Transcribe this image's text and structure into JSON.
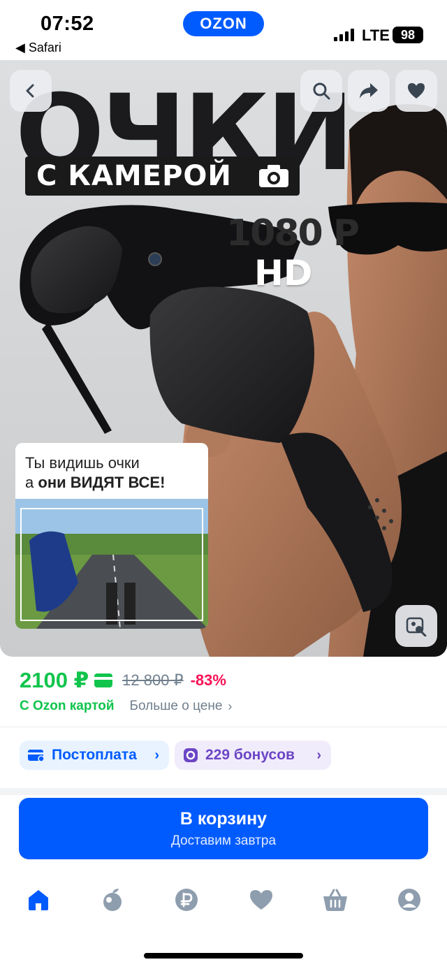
{
  "status_bar": {
    "time": "07:52",
    "back_app": "◀ Safari",
    "network": "LTE",
    "battery": "98"
  },
  "brand": {
    "logo": "OZON",
    "primary_color": "#005bff"
  },
  "product_image": {
    "title": "ОЧКИ",
    "subtitle": "С КАМЕРОЙ",
    "resolution": "1080 P",
    "quality": "HD",
    "promo_line1": "Ты видишь очки",
    "promo_line2_prefix": "а",
    "promo_line2_bold": "они ВИДЯТ ВСЕ!",
    "buttons": [
      "back-icon",
      "search-icon",
      "share-icon",
      "heart-icon",
      "image-search-icon"
    ]
  },
  "price": {
    "current": "2100 ₽",
    "old": "12 800 ₽",
    "discount": "-83%",
    "ozon_card_label": "С Ozon картой",
    "more_about_price": "Больше о цене",
    "green": "#10c44c",
    "red": "#f91155"
  },
  "chips": {
    "postpay": "Постоплата",
    "bonuses": "229 бонусов"
  },
  "cart": {
    "label": "В корзину",
    "delivery": "Доставим завтра"
  },
  "bottom_nav": {
    "items": [
      "home-icon",
      "fresh-icon",
      "ruble-icon",
      "favorites-icon",
      "cart-icon",
      "profile-icon"
    ],
    "active": "home-icon"
  }
}
